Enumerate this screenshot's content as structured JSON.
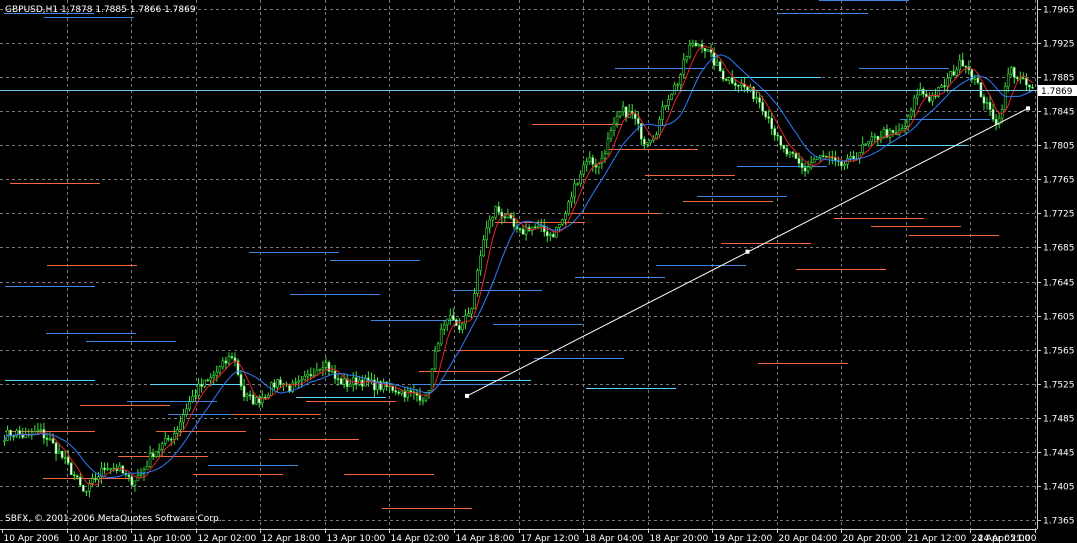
{
  "chart_data": {
    "type": "candlestick",
    "title": "GBPUSD,H1  1.7878 1.7885 1.7866 1.7869",
    "footer": "SBFX, © 2001-2006 MetaQuotes Software Corp.",
    "current_price": "1.7869",
    "current_price_value": 1.7869,
    "ylim": [
      1.7355,
      1.7975
    ],
    "y_ticks": [
      "1.7965",
      "1.7925",
      "1.7885",
      "1.7845",
      "1.7805",
      "1.7765",
      "1.7725",
      "1.7685",
      "1.7645",
      "1.7605",
      "1.7565",
      "1.7525",
      "1.7485",
      "1.7445",
      "1.7405",
      "1.7365"
    ],
    "x_ticks": [
      "10 Apr 2006",
      "10 Apr 18:00",
      "11 Apr 10:00",
      "12 Apr 02:00",
      "12 Apr 18:00",
      "13 Apr 10:00",
      "14 Apr 02:00",
      "14 Apr 18:00",
      "17 Apr 12:00",
      "18 Apr 04:00",
      "18 Apr 20:00",
      "19 Apr 12:00",
      "20 Apr 04:00",
      "20 Apr 20:00",
      "21 Apr 12:00",
      "24 Apr 05:00",
      "24 Apr 21:00"
    ],
    "price_path": [
      1.7465,
      1.7468,
      1.7462,
      1.747,
      1.7458,
      1.744,
      1.742,
      1.7395,
      1.7415,
      1.743,
      1.7425,
      1.741,
      1.742,
      1.7445,
      1.7455,
      1.747,
      1.75,
      1.752,
      1.753,
      1.7545,
      1.756,
      1.751,
      1.7505,
      1.7515,
      1.753,
      1.752,
      1.7525,
      1.754,
      1.7552,
      1.753,
      1.7525,
      1.753,
      1.7525,
      1.7522,
      1.752,
      1.7515,
      1.7512,
      1.751,
      1.758,
      1.76,
      1.759,
      1.762,
      1.77,
      1.773,
      1.772,
      1.77,
      1.771,
      1.7705,
      1.77,
      1.772,
      1.776,
      1.779,
      1.778,
      1.7815,
      1.7845,
      1.784,
      1.781,
      1.782,
      1.786,
      1.788,
      1.792,
      1.7925,
      1.7905,
      1.7885,
      1.788,
      1.787,
      1.786,
      1.7835,
      1.78,
      1.779,
      1.7775,
      1.779,
      1.779,
      1.778,
      1.7785,
      1.78,
      1.781,
      1.782,
      1.7815,
      1.783,
      1.787,
      1.786,
      1.787,
      1.789,
      1.7905,
      1.788,
      1.785,
      1.783,
      1.7895,
      1.788,
      1.7869
    ],
    "trendline": {
      "start": 1.7511,
      "mid": 1.768,
      "end": 1.7848
    },
    "levels": {
      "blue": [
        1.764,
        1.7585,
        1.7575,
        1.7505,
        1.749,
        1.743,
        1.768,
        1.763,
        1.767,
        1.76,
        1.7525,
        1.7635,
        1.7595,
        1.7555,
        1.765,
        1.7895,
        1.7665,
        1.7745,
        1.778,
        1.796,
        1.7975,
        1.7895,
        1.7835,
        1.796,
        1.7955
      ],
      "cyan": [
        1.753,
        1.7525,
        1.751,
        1.753,
        1.752,
        1.7885,
        1.7805
      ],
      "orange": [
        1.747,
        1.7415,
        1.75,
        1.744,
        1.747,
        1.742,
        1.749,
        1.746,
        1.7505,
        1.742,
        1.738,
        1.754,
        1.7565,
        1.7715,
        1.783,
        1.7725,
        1.78,
        1.777,
        1.774,
        1.769,
        1.755,
        1.766,
        1.772,
        1.771,
        1.77,
        1.776,
        1.7665
      ]
    },
    "grid": true
  }
}
